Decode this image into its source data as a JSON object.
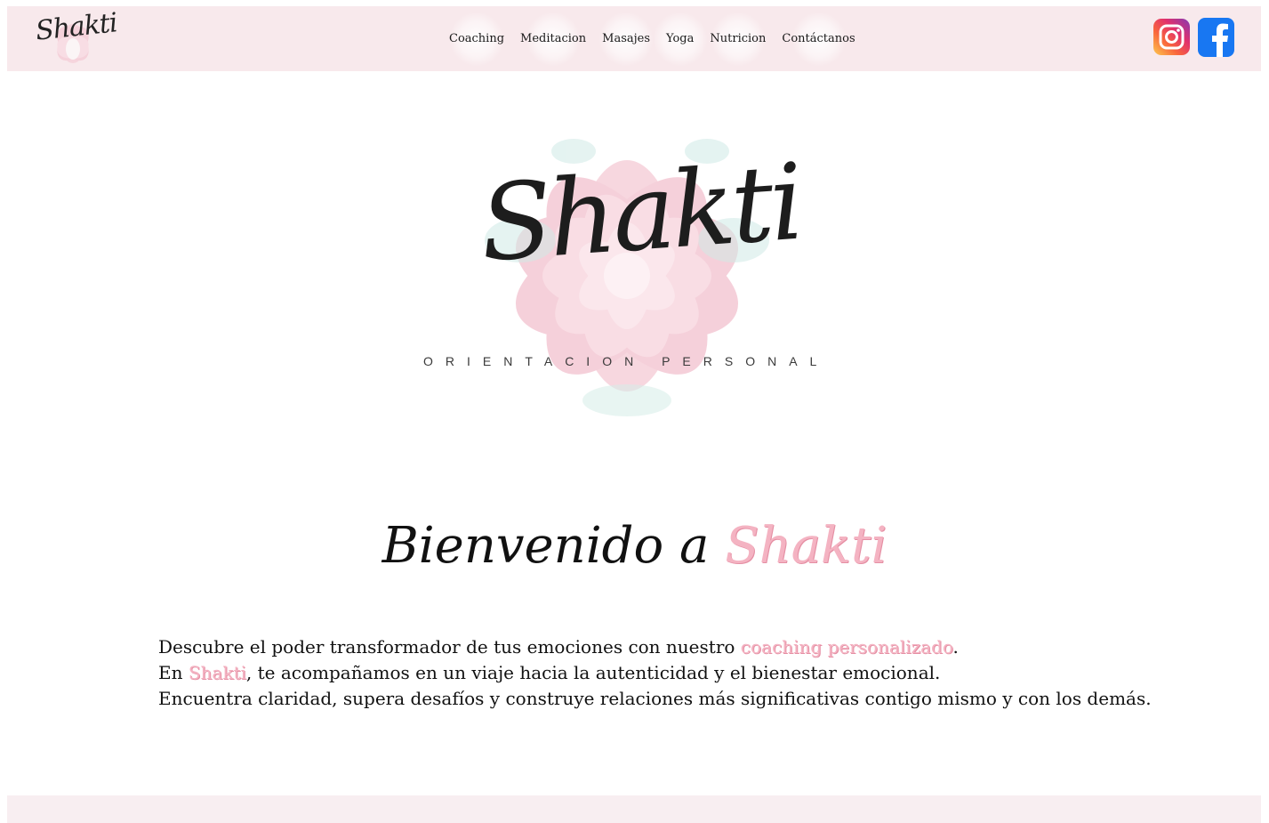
{
  "header": {
    "logo_text": "Shakti",
    "nav": [
      {
        "label": "Coaching"
      },
      {
        "label": "Meditacion"
      },
      {
        "label": "Masajes"
      },
      {
        "label": "Yoga"
      },
      {
        "label": "Nutricion"
      },
      {
        "label": "Contáctanos"
      }
    ],
    "social": [
      {
        "icon": "instagram-icon"
      },
      {
        "icon": "facebook-icon"
      }
    ]
  },
  "hero": {
    "script_text": "Shakti",
    "subtitle": "ORIENTACION PERSONAL"
  },
  "welcome": {
    "prefix": "Bienvenido a",
    "brand": "Shakti"
  },
  "description": {
    "line1_before": "Descubre el poder transformador de tus emociones con nuestro ",
    "line1_highlight": "coaching personalizado",
    "line1_after": ".",
    "line2_before": "En ",
    "line2_highlight": "Shakti",
    "line2_after": ", te acompañamos en un viaje hacia la autenticidad y el bienestar emocional.",
    "line3": "Encuentra claridad, supera desafíos y construye relaciones más significativas contigo mismo y con los demás."
  },
  "colors": {
    "header_bg": "#f8e9ec",
    "accent_pink": "#f4b3c2",
    "text": "#111111"
  }
}
